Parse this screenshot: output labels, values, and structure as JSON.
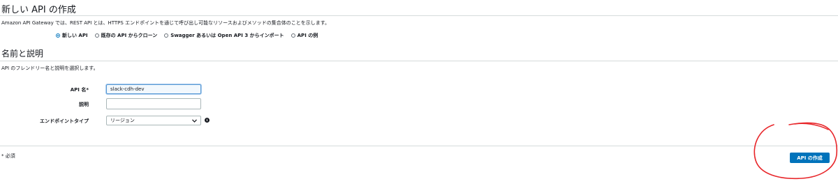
{
  "section_create": {
    "title": "新しい API の作成",
    "description": "Amazon API Gateway では、REST API とは、HTTPS エンドポイントを通じて呼び出し可能なリソースおよびメソッドの集合体のことを示します。",
    "options": [
      {
        "label": "新しい API",
        "checked": true
      },
      {
        "label": "既存の API からクローン",
        "checked": false
      },
      {
        "label": "Swagger あるいは Open API 3 からインポート",
        "checked": false
      },
      {
        "label": "API の例",
        "checked": false
      }
    ]
  },
  "section_name": {
    "title": "名前と説明",
    "description": "API のフレンドリー名と説明を選択します。",
    "api_name_label": "API 名*",
    "api_name_value": "slack-cdh-dev",
    "description_label": "説明",
    "description_value": "",
    "endpoint_label": "エンドポイントタイプ",
    "endpoint_value": "リージョン",
    "info_icon_glyph": "i"
  },
  "footer": {
    "required_note": "* 必須",
    "create_button": "API の作成"
  },
  "colors": {
    "primary": "#0073bb",
    "annotation": "#e8262a"
  }
}
